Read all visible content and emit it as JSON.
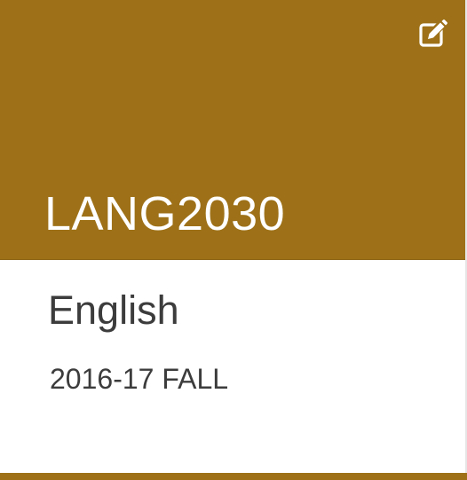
{
  "card": {
    "color": "#9E7118",
    "course_code": "LANG2030",
    "course_name": "English",
    "term": "2016-17 FALL",
    "edit_icon": "edit-icon"
  }
}
